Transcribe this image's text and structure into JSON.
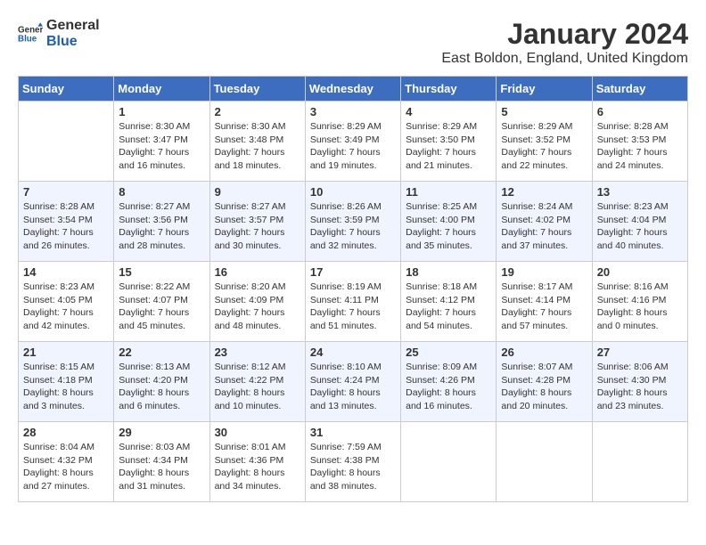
{
  "header": {
    "logo_line1": "General",
    "logo_line2": "Blue",
    "month": "January 2024",
    "location": "East Boldon, England, United Kingdom"
  },
  "days_of_week": [
    "Sunday",
    "Monday",
    "Tuesday",
    "Wednesday",
    "Thursday",
    "Friday",
    "Saturday"
  ],
  "weeks": [
    [
      {
        "day": "",
        "info": ""
      },
      {
        "day": "1",
        "info": "Sunrise: 8:30 AM\nSunset: 3:47 PM\nDaylight: 7 hours\nand 16 minutes."
      },
      {
        "day": "2",
        "info": "Sunrise: 8:30 AM\nSunset: 3:48 PM\nDaylight: 7 hours\nand 18 minutes."
      },
      {
        "day": "3",
        "info": "Sunrise: 8:29 AM\nSunset: 3:49 PM\nDaylight: 7 hours\nand 19 minutes."
      },
      {
        "day": "4",
        "info": "Sunrise: 8:29 AM\nSunset: 3:50 PM\nDaylight: 7 hours\nand 21 minutes."
      },
      {
        "day": "5",
        "info": "Sunrise: 8:29 AM\nSunset: 3:52 PM\nDaylight: 7 hours\nand 22 minutes."
      },
      {
        "day": "6",
        "info": "Sunrise: 8:28 AM\nSunset: 3:53 PM\nDaylight: 7 hours\nand 24 minutes."
      }
    ],
    [
      {
        "day": "7",
        "info": "Sunrise: 8:28 AM\nSunset: 3:54 PM\nDaylight: 7 hours\nand 26 minutes."
      },
      {
        "day": "8",
        "info": "Sunrise: 8:27 AM\nSunset: 3:56 PM\nDaylight: 7 hours\nand 28 minutes."
      },
      {
        "day": "9",
        "info": "Sunrise: 8:27 AM\nSunset: 3:57 PM\nDaylight: 7 hours\nand 30 minutes."
      },
      {
        "day": "10",
        "info": "Sunrise: 8:26 AM\nSunset: 3:59 PM\nDaylight: 7 hours\nand 32 minutes."
      },
      {
        "day": "11",
        "info": "Sunrise: 8:25 AM\nSunset: 4:00 PM\nDaylight: 7 hours\nand 35 minutes."
      },
      {
        "day": "12",
        "info": "Sunrise: 8:24 AM\nSunset: 4:02 PM\nDaylight: 7 hours\nand 37 minutes."
      },
      {
        "day": "13",
        "info": "Sunrise: 8:23 AM\nSunset: 4:04 PM\nDaylight: 7 hours\nand 40 minutes."
      }
    ],
    [
      {
        "day": "14",
        "info": "Sunrise: 8:23 AM\nSunset: 4:05 PM\nDaylight: 7 hours\nand 42 minutes."
      },
      {
        "day": "15",
        "info": "Sunrise: 8:22 AM\nSunset: 4:07 PM\nDaylight: 7 hours\nand 45 minutes."
      },
      {
        "day": "16",
        "info": "Sunrise: 8:20 AM\nSunset: 4:09 PM\nDaylight: 7 hours\nand 48 minutes."
      },
      {
        "day": "17",
        "info": "Sunrise: 8:19 AM\nSunset: 4:11 PM\nDaylight: 7 hours\nand 51 minutes."
      },
      {
        "day": "18",
        "info": "Sunrise: 8:18 AM\nSunset: 4:12 PM\nDaylight: 7 hours\nand 54 minutes."
      },
      {
        "day": "19",
        "info": "Sunrise: 8:17 AM\nSunset: 4:14 PM\nDaylight: 7 hours\nand 57 minutes."
      },
      {
        "day": "20",
        "info": "Sunrise: 8:16 AM\nSunset: 4:16 PM\nDaylight: 8 hours\nand 0 minutes."
      }
    ],
    [
      {
        "day": "21",
        "info": "Sunrise: 8:15 AM\nSunset: 4:18 PM\nDaylight: 8 hours\nand 3 minutes."
      },
      {
        "day": "22",
        "info": "Sunrise: 8:13 AM\nSunset: 4:20 PM\nDaylight: 8 hours\nand 6 minutes."
      },
      {
        "day": "23",
        "info": "Sunrise: 8:12 AM\nSunset: 4:22 PM\nDaylight: 8 hours\nand 10 minutes."
      },
      {
        "day": "24",
        "info": "Sunrise: 8:10 AM\nSunset: 4:24 PM\nDaylight: 8 hours\nand 13 minutes."
      },
      {
        "day": "25",
        "info": "Sunrise: 8:09 AM\nSunset: 4:26 PM\nDaylight: 8 hours\nand 16 minutes."
      },
      {
        "day": "26",
        "info": "Sunrise: 8:07 AM\nSunset: 4:28 PM\nDaylight: 8 hours\nand 20 minutes."
      },
      {
        "day": "27",
        "info": "Sunrise: 8:06 AM\nSunset: 4:30 PM\nDaylight: 8 hours\nand 23 minutes."
      }
    ],
    [
      {
        "day": "28",
        "info": "Sunrise: 8:04 AM\nSunset: 4:32 PM\nDaylight: 8 hours\nand 27 minutes."
      },
      {
        "day": "29",
        "info": "Sunrise: 8:03 AM\nSunset: 4:34 PM\nDaylight: 8 hours\nand 31 minutes."
      },
      {
        "day": "30",
        "info": "Sunrise: 8:01 AM\nSunset: 4:36 PM\nDaylight: 8 hours\nand 34 minutes."
      },
      {
        "day": "31",
        "info": "Sunrise: 7:59 AM\nSunset: 4:38 PM\nDaylight: 8 hours\nand 38 minutes."
      },
      {
        "day": "",
        "info": ""
      },
      {
        "day": "",
        "info": ""
      },
      {
        "day": "",
        "info": ""
      }
    ]
  ]
}
